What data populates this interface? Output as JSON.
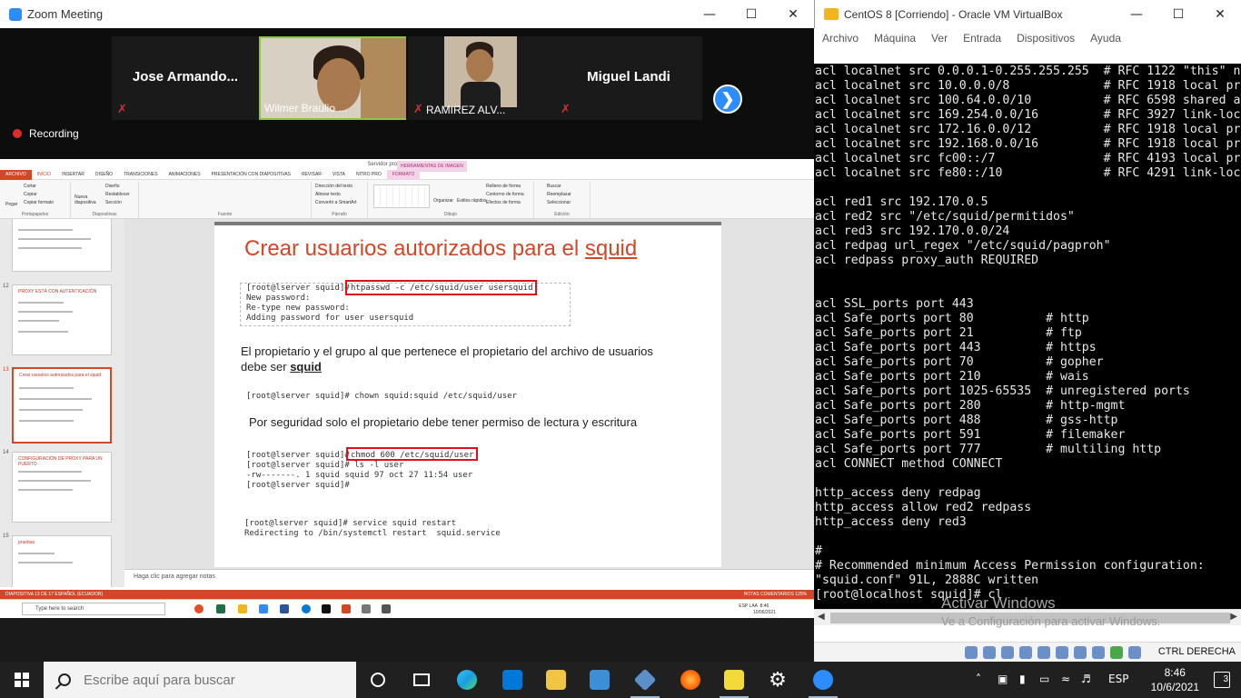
{
  "zoom": {
    "title": "Zoom Meeting",
    "participants": [
      {
        "name": "Jose Armando...",
        "video": false
      },
      {
        "name": "Wilmer Braulio ...",
        "video": true,
        "active": true
      },
      {
        "name": "RAMIREZ ALV...",
        "video": true
      },
      {
        "name": "Miguel Landi",
        "video": false
      }
    ],
    "next_icon": "chevron-right-icon",
    "recording_label": "Recording"
  },
  "ppt": {
    "title": "Servidor proxy.pptx - PowerPoint",
    "context_tab": "HERRAMIENTAS DE IMAGEN",
    "tabs": [
      "ARCHIVO",
      "INICIO",
      "INSERTAR",
      "DISEÑO",
      "TRANSICIONES",
      "ANIMACIONES",
      "PRESENTACIÓN CON DIAPOSITIVAS",
      "REVISAR",
      "VISTA",
      "NITRO PRO",
      "FORMATO"
    ],
    "ribbon": {
      "paste": "Pegar",
      "cut": "Cortar",
      "copy": "Copiar",
      "format_copy": "Copiar formato",
      "new_slide": "Nueva diapositiva",
      "layout": "Diseño",
      "reset": "Restablecer",
      "section": "Sección",
      "text_direction": "Dirección del texto",
      "align_text": "Alinear texto",
      "smartart": "Convertir a SmartArt",
      "arrange": "Organizar",
      "quick_styles": "Estilos rápidos",
      "shape_fill": "Relleno de forma",
      "shape_outline": "Contorno de forma",
      "shape_effects": "Efectos de forma",
      "find": "Buscar",
      "replace": "Reemplazar",
      "select": "Seleccionar",
      "groups": [
        "Portapapeles",
        "Diapositivas",
        "Fuente",
        "Párrafo",
        "Dibujo",
        "Edición"
      ]
    },
    "thumbs": [
      {
        "num": "",
        "title": ""
      },
      {
        "num": "12",
        "title": "PROXY ESTÁ CON AUTENTICACIÓN"
      },
      {
        "num": "13",
        "title": "Crear usuarios autorizados para el squid",
        "selected": true
      },
      {
        "num": "14",
        "title": "CONFIGURACIÓN DE PROXY PARA UN PUERTO"
      },
      {
        "num": "15",
        "title": "pruebas"
      }
    ],
    "slide": {
      "title_main": "Crear usuarios autorizados para el ",
      "title_link": "squid",
      "term1_prompt": "[root@lserver squid]#",
      "term1_cmd": "htpasswd -c /etc/squid/user usersquid",
      "term1_rest": "New password:\nRe-type new password:\nAdding password for user usersquid",
      "text1": "El propietario y el grupo al que pertenece el propietario del archivo de usuarios debe ser ",
      "text1_bold": "squid",
      "term2": "[root@lserver squid]# chown squid:squid /etc/squid/user",
      "text2": "Por seguridad solo el propietario debe tener permiso de lectura y escritura",
      "term3_prompt": "[root@lserver squid]#",
      "term3_cmd": "chmod 600 /etc/squid/user",
      "term3_rest": "[root@lserver squid]# ls -l user\n-rw-------. 1 squid squid 97 oct 27 11:54 user\n[root@lserver squid]#",
      "term4": "[root@lserver squid]# service squid restart\nRedirecting to /bin/systemctl restart  squid.service"
    },
    "notes_placeholder": "Haga clic para agregar notas",
    "status_left": "DIAPOSITIVA 13 DE 17     ESPAÑOL (ECUADOR)",
    "status_right": "NOTAS    COMENTARIOS    125%",
    "inner_search": "Type here to search",
    "inner_lang": "ESP LAA",
    "inner_clock": "8:46",
    "inner_date": "10/06/2021"
  },
  "vbox": {
    "title": "CentOS 8 [Corriendo] - Oracle VM VirtualBox",
    "menu": [
      "Archivo",
      "Máquina",
      "Ver",
      "Entrada",
      "Dispositivos",
      "Ayuda"
    ],
    "console": "acl localnet src 0.0.0.1-0.255.255.255  # RFC 1122 \"this\" n\nacl localnet src 10.0.0.0/8             # RFC 1918 local pr\nacl localnet src 100.64.0.0/10          # RFC 6598 shared a\nacl localnet src 169.254.0.0/16         # RFC 3927 link-loc\nacl localnet src 172.16.0.0/12          # RFC 1918 local pr\nacl localnet src 192.168.0.0/16         # RFC 1918 local pr\nacl localnet src fc00::/7               # RFC 4193 local pr\nacl localnet src fe80::/10              # RFC 4291 link-loc\n\nacl red1 src 192.170.0.5\nacl red2 src \"/etc/squid/permitidos\"\nacl red3 src 192.170.0.0/24\nacl redpag url_regex \"/etc/squid/pagproh\"\nacl redpass proxy_auth REQUIRED\n\n\nacl SSL_ports port 443\nacl Safe_ports port 80          # http\nacl Safe_ports port 21          # ftp\nacl Safe_ports port 443         # https\nacl Safe_ports port 70          # gopher\nacl Safe_ports port 210         # wais\nacl Safe_ports port 1025-65535  # unregistered ports\nacl Safe_ports port 280         # http-mgmt\nacl Safe_ports port 488         # gss-http\nacl Safe_ports port 591         # filemaker\nacl Safe_ports port 777         # multiling http\nacl CONNECT method CONNECT\n\nhttp_access deny redpag\nhttp_access allow red2 redpass\nhttp_access deny red3\n\n#\n# Recommended minimum Access Permission configuration:\n\"squid.conf\" 91L, 2888C written\n[root@localhost squid]# cl",
    "activate_title": "Activar Windows",
    "activate_sub": "Ve a Configuración para activar Windows.",
    "host_key": "CTRL DERECHA"
  },
  "taskbar": {
    "search_placeholder": "Escribe aquí para buscar",
    "apps": [
      "cortana-icon",
      "task-view-icon",
      "edge-icon",
      "store-icon",
      "file-explorer-icon",
      "network-app-icon",
      "virtualbox-icon",
      "firefox-icon",
      "sticky-notes-icon",
      "settings-icon",
      "zoom-icon"
    ],
    "lang": "ESP",
    "time": "8:46",
    "date": "10/6/2021",
    "notifications": "3"
  }
}
